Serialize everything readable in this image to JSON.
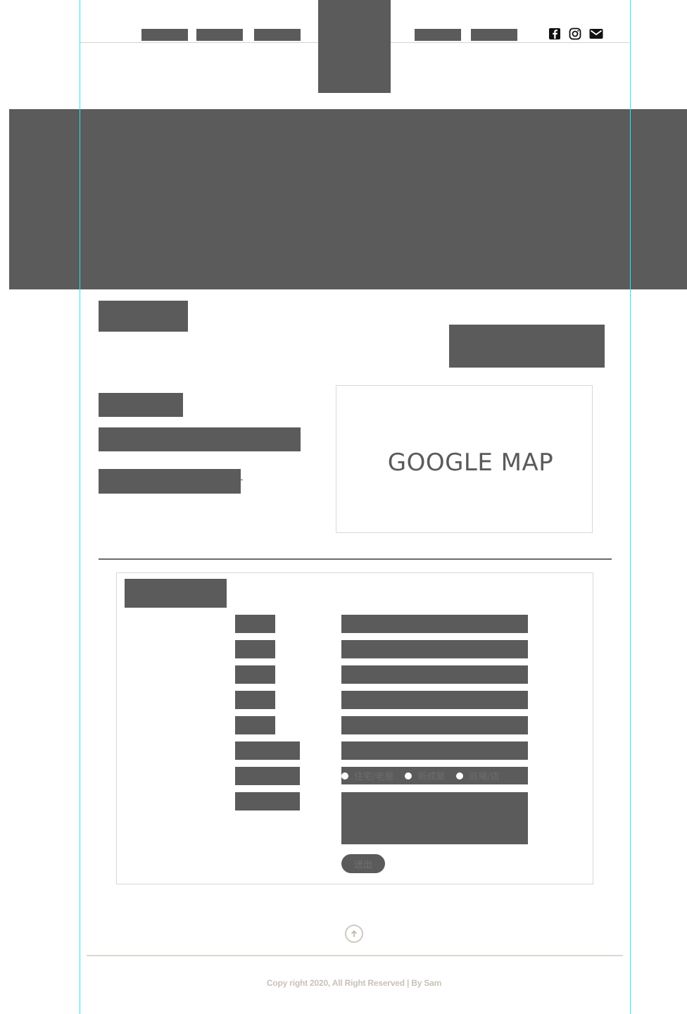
{
  "header": {
    "nav_left_count": 3,
    "nav_right_count": 2,
    "social_icons": [
      "facebook-icon",
      "instagram-icon",
      "mail-icon"
    ]
  },
  "map": {
    "label": "GOOGLE MAP"
  },
  "form": {
    "radio_options": [
      "住宅/老屋",
      "新成屋",
      "商場/店"
    ],
    "submit_label": "送出"
  },
  "footer": {
    "copyright": "Copy right 2020, All Right Reserved | By Sam"
  },
  "colors": {
    "placeholder_block": "#5b5b5b",
    "guide_line": "#24e8f0",
    "divider": "#d6d3cc",
    "footer_text": "#c8c2b7"
  }
}
